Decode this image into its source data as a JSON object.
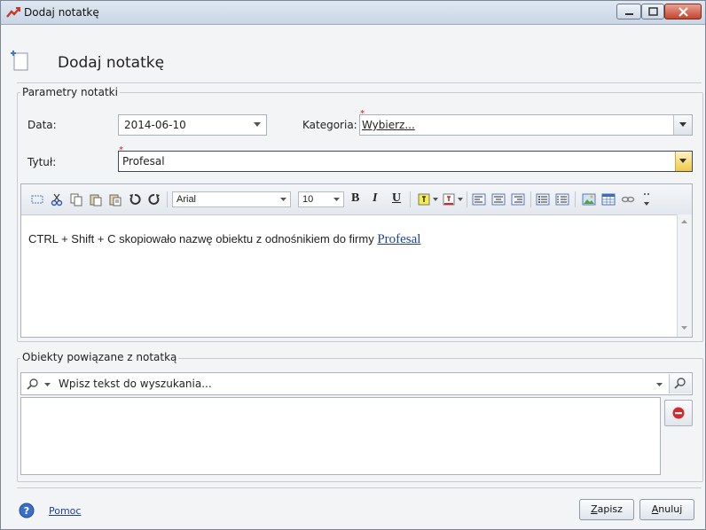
{
  "window": {
    "title": "Dodaj notatkę"
  },
  "header": {
    "title": "Dodaj notatkę"
  },
  "params": {
    "group_label": "Parametry notatki",
    "date_label": "Data:",
    "date_value": "2014-06-10",
    "category_label": "Kategoria:",
    "category_value": "Wybierz...",
    "title_label": "Tytuł:",
    "title_value": "Profesal"
  },
  "editor": {
    "font": "Arial",
    "size": "10",
    "bold": "B",
    "italic": "I",
    "underline": "U",
    "content_text": "CTRL + Shift + C skopiowało nazwę obiektu z odnośnikiem do firmy ",
    "content_link": "Profesal"
  },
  "related": {
    "group_label": "Obiekty powiązane z notatką",
    "search_placeholder": "Wpisz tekst do wyszukania..."
  },
  "footer": {
    "help_label": "Pomoc",
    "save_first": "Z",
    "save_rest": "apisz",
    "cancel_first": "A",
    "cancel_rest": "nuluj"
  },
  "colors": {
    "accent": "#1c3fa8",
    "required": "#d42020",
    "delete": "#d22b2b"
  }
}
